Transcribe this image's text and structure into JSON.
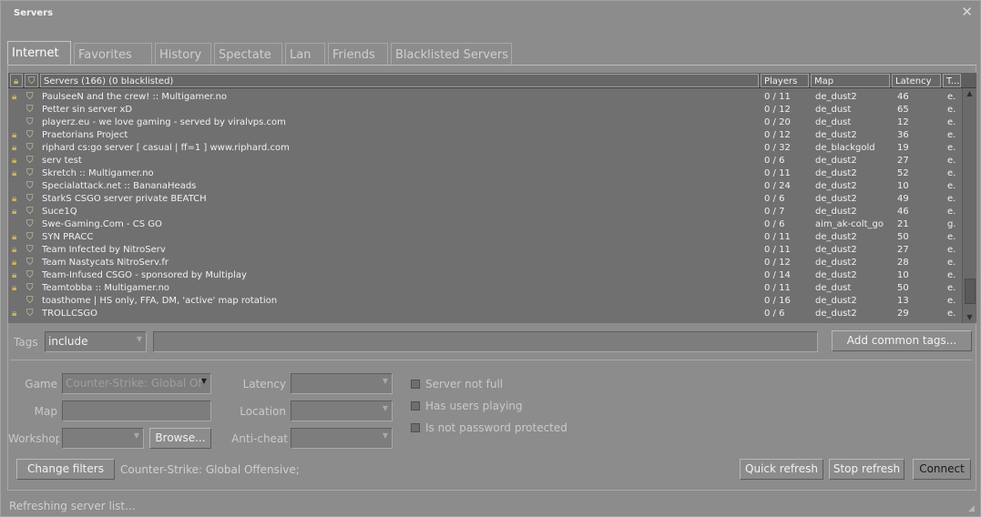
{
  "window": {
    "title": "Servers",
    "close_glyph": "✕"
  },
  "tabs": [
    {
      "label": "Internet",
      "active": true
    },
    {
      "label": "Favorites",
      "active": false
    },
    {
      "label": "History",
      "active": false
    },
    {
      "label": "Spectate",
      "active": false
    },
    {
      "label": "Lan",
      "active": false
    },
    {
      "label": "Friends",
      "active": false
    },
    {
      "label": "Blacklisted Servers",
      "active": false
    }
  ],
  "columns": {
    "lock_icon": "lock-icon",
    "secure_icon": "shield-icon",
    "servers": "Servers (166) (0 blacklisted)",
    "players": "Players",
    "map": "Map",
    "latency": "Latency",
    "tags": "T..."
  },
  "servers": [
    {
      "locked": true,
      "name": "PaulseeN and the crew! :: Multigamer.no",
      "players": "0 / 11",
      "map": "de_dust2",
      "latency": "46",
      "tags": "e."
    },
    {
      "locked": false,
      "name": "Petter sin server xD",
      "players": "0 / 12",
      "map": "de_dust",
      "latency": "65",
      "tags": "e."
    },
    {
      "locked": false,
      "name": "playerz.eu - we love gaming - served by viralvps.com",
      "players": "0 / 20",
      "map": "de_dust",
      "latency": "12",
      "tags": "e."
    },
    {
      "locked": true,
      "name": "Praetorians Project",
      "players": "0 / 12",
      "map": "de_dust2",
      "latency": "36",
      "tags": "e."
    },
    {
      "locked": true,
      "name": "riphard cs:go server [ casual | ff=1 ] www.riphard.com",
      "players": "0 / 32",
      "map": "de_blackgold",
      "latency": "19",
      "tags": "e."
    },
    {
      "locked": true,
      "name": "serv test",
      "players": "0 / 6",
      "map": "de_dust2",
      "latency": "27",
      "tags": "e."
    },
    {
      "locked": true,
      "name": "Skretch :: Multigamer.no",
      "players": "0 / 11",
      "map": "de_dust2",
      "latency": "52",
      "tags": "e."
    },
    {
      "locked": false,
      "name": "Specialattack.net :: BananaHeads",
      "players": "0 / 24",
      "map": "de_dust2",
      "latency": "10",
      "tags": "e."
    },
    {
      "locked": true,
      "name": "StarkS CSGO server private BEATCH",
      "players": "0 / 6",
      "map": "de_dust2",
      "latency": "49",
      "tags": "e."
    },
    {
      "locked": true,
      "name": "Suce1Q",
      "players": "0 / 7",
      "map": "de_dust2",
      "latency": "46",
      "tags": "e."
    },
    {
      "locked": false,
      "name": "Swe-Gaming.Com - CS GO",
      "players": "0 / 6",
      "map": "aim_ak-colt_go",
      "latency": "21",
      "tags": "g."
    },
    {
      "locked": true,
      "name": "SYN PRACC",
      "players": "0 / 11",
      "map": "de_dust2",
      "latency": "50",
      "tags": "e."
    },
    {
      "locked": true,
      "name": "Team Infected by NitroServ",
      "players": "0 / 11",
      "map": "de_dust2",
      "latency": "27",
      "tags": "e."
    },
    {
      "locked": true,
      "name": "Team Nastycats NitroServ.fr",
      "players": "0 / 12",
      "map": "de_dust2",
      "latency": "28",
      "tags": "e."
    },
    {
      "locked": true,
      "name": "Team-Infused CSGO - sponsored by Multiplay",
      "players": "0 / 14",
      "map": "de_dust2",
      "latency": "10",
      "tags": "e."
    },
    {
      "locked": true,
      "name": "Teamtobba :: Multigamer.no",
      "players": "0 / 11",
      "map": "de_dust",
      "latency": "50",
      "tags": "e."
    },
    {
      "locked": false,
      "name": "toasthome | HS only, FFA, DM, 'active' map rotation",
      "players": "0 / 16",
      "map": "de_dust2",
      "latency": "13",
      "tags": "e."
    },
    {
      "locked": true,
      "name": "TROLLCSGO",
      "players": "0 / 6",
      "map": "de_dust2",
      "latency": "29",
      "tags": "e."
    }
  ],
  "tags_filter": {
    "label": "Tags",
    "mode": "include",
    "value": "",
    "add_button": "Add common tags..."
  },
  "filters": {
    "game_label": "Game",
    "game_value": "Counter-Strike: Global Of",
    "map_label": "Map",
    "map_value": "",
    "workshop_label": "Workshop",
    "workshop_value": "",
    "browse_button": "Browse...",
    "latency_label": "Latency",
    "location_label": "Location",
    "anticheat_label": "Anti-cheat",
    "server_not_full": "Server not full",
    "has_users_playing": "Has users playing",
    "not_password_protected": "Is not password protected"
  },
  "footer": {
    "change_filters": "Change filters",
    "filter_summary": "Counter-Strike: Global Offensive;",
    "quick_refresh": "Quick refresh",
    "stop_refresh": "Stop refresh",
    "connect": "Connect",
    "status": "Refreshing server list..."
  },
  "colors": {
    "background": "#8c8c8c",
    "list_background": "#707070",
    "lock_icon": "#cfb35a"
  }
}
